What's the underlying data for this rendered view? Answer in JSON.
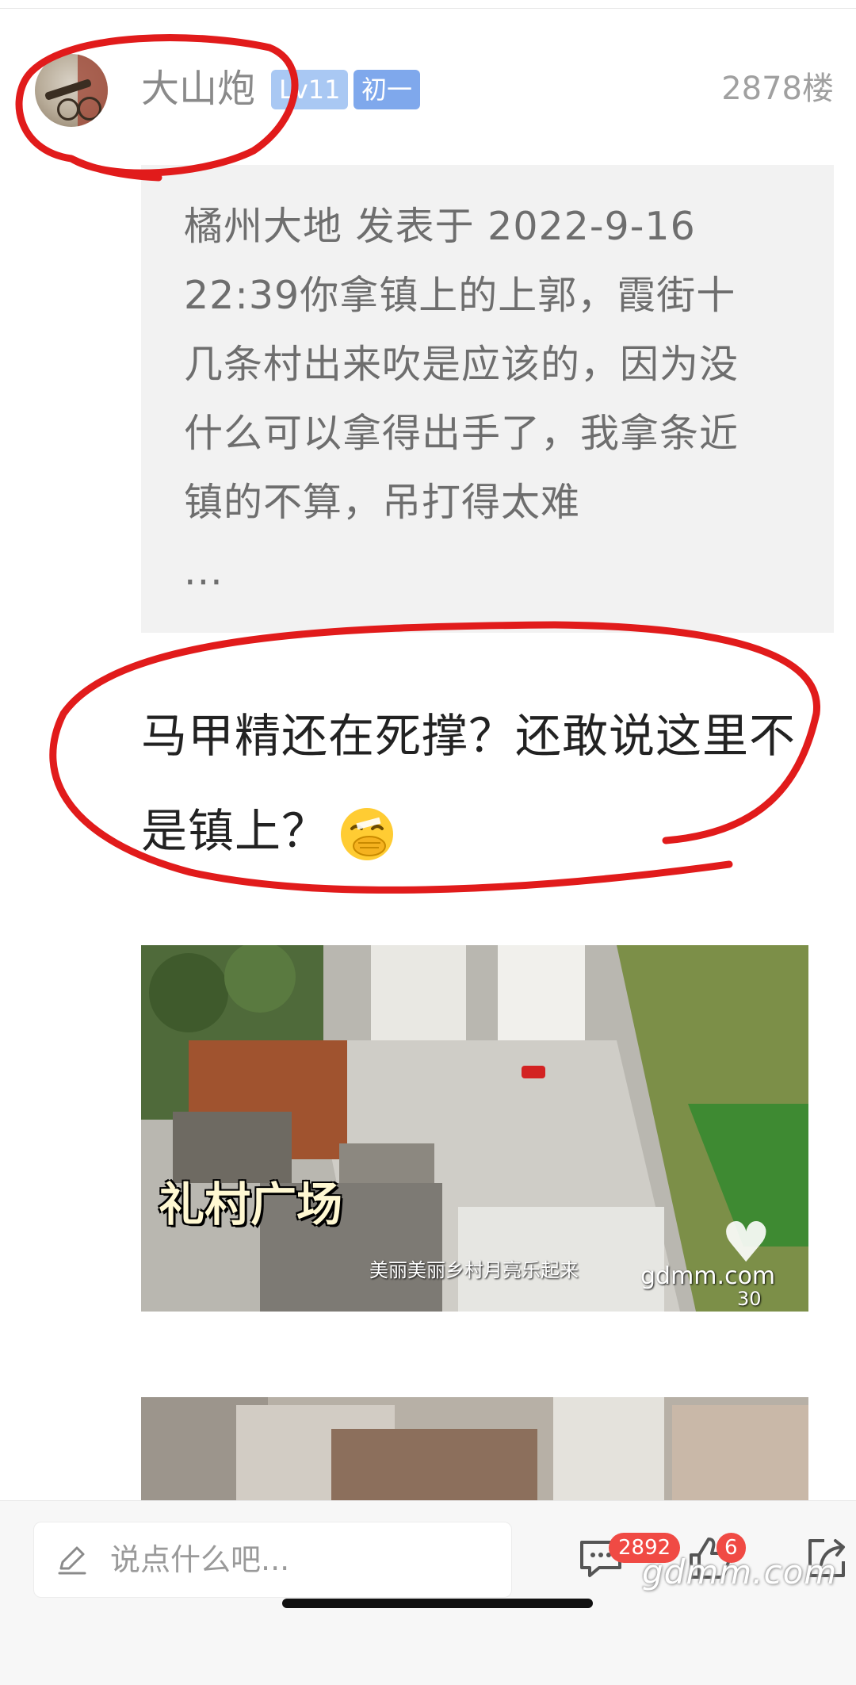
{
  "post": {
    "username": "大山炮",
    "level_badge": "Lv11",
    "rank_badge": "初一",
    "floor": "2878楼"
  },
  "quote": {
    "text": "橘州大地 发表于 2022-9-16 22:39你拿镇上的上郭，霞街十几条村出来吹是应该的，因为没什么可以拿得出手了，我拿条近镇的不算，吊打得太难\n..."
  },
  "reply": {
    "text": "马甲精还在死撑？还敢说这里不是镇上？",
    "emoji": "face-with-hand-over-mouth-emoji"
  },
  "images": {
    "first": {
      "caption": "礼村广场",
      "subtitle": "美丽美丽乡村月亮乐起来",
      "watermark_site": "gdmm.com",
      "watermark_number": "30"
    }
  },
  "bottom_bar": {
    "input_placeholder": "说点什么吧...",
    "comment_count": "2892",
    "like_count": "6"
  },
  "watermark": "gdmm.com",
  "colors": {
    "badge_light": "#a9c8f3",
    "badge_blue": "#7fa8ec",
    "count_badge": "#f04a44",
    "annotation_red": "#e11b1b"
  }
}
